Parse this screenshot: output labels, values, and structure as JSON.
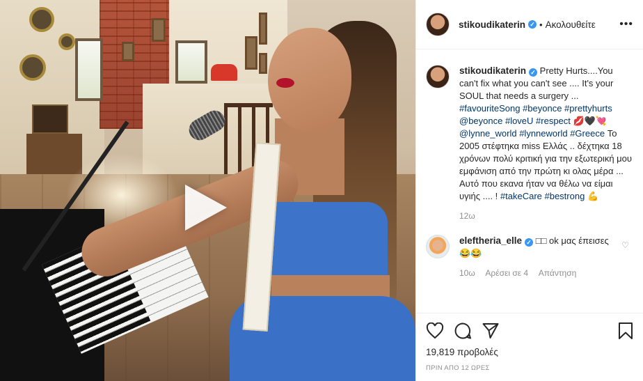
{
  "post": {
    "author": "stikoudikaterin",
    "follow_status": "Ακολουθείτε",
    "dot": "•",
    "more": "•••",
    "caption": {
      "line1": "Pretty Hurts....You can't fix what you can't see .... It's your SOUL that needs a surgery ...",
      "tags1": "#favouriteSong #beyonce #prettyhurts @beyonce #loveU #respect",
      "emoji": "💋🖤💘",
      "mention2": "@lynne_world",
      "tags2": "#lynneworld #Greece",
      "line2": "Το 2005 στέφτηκα miss Ελλάς .. δέχτηκα 18 χρόνων πολύ κριτική για την εξωτερική μου εμφάνιση από την πρώτη κι ολας μέρα ... Αυτό που εκανα ήταν να θέλω να είμαι υγιής .... !",
      "tags3": "#takeCare #bestrong",
      "emoji_end": "💪",
      "age": "12ω"
    },
    "comment": {
      "user": "eleftheria_elle",
      "text": "□□ ok μας έπεισες 😂😂",
      "age": "10ω",
      "likes": "Αρέσει σε 4",
      "reply": "Απάντηση"
    },
    "likes_count": "19,819 προβολές",
    "time_ago": "ΠΡΙΝ ΑΠΟ 12 ΩΡΕΣ"
  },
  "icons": [
    "play-icon",
    "verified-icon",
    "more-icon",
    "heart-icon",
    "comment-icon",
    "share-icon",
    "bookmark-icon"
  ],
  "colors": {
    "link": "#003569",
    "verified": "#3897f0",
    "muted": "#8e8e8e"
  }
}
